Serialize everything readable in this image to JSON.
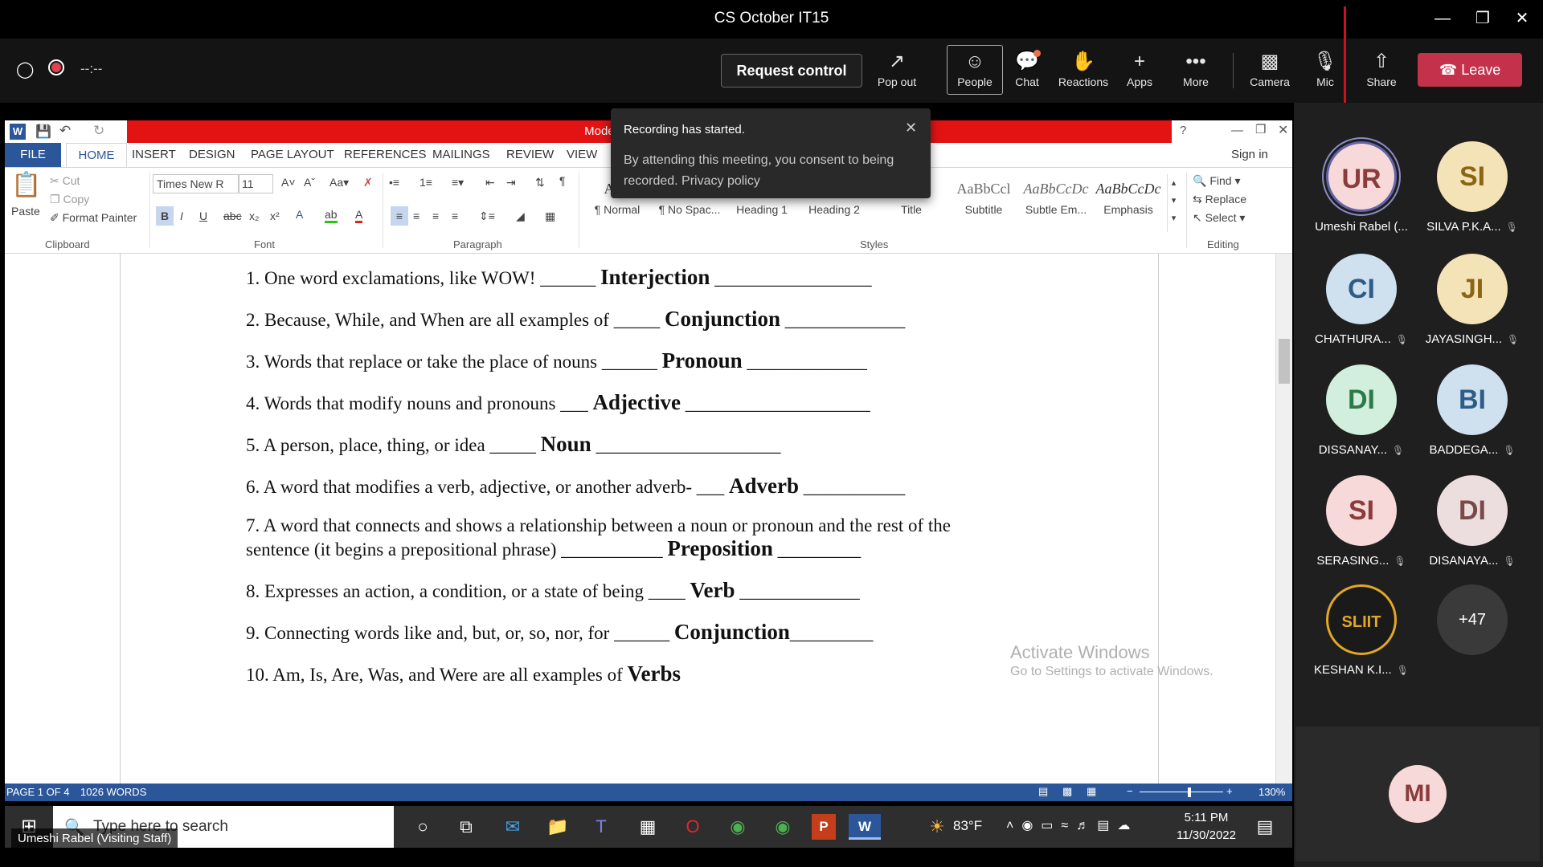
{
  "window": {
    "title": "CS October IT15"
  },
  "controls": {
    "timer": "--:--",
    "request_control": "Request control",
    "pop_out": "Pop out",
    "people": "People",
    "chat": "Chat",
    "reactions": "Reactions",
    "apps": "Apps",
    "more": "More",
    "camera": "Camera",
    "mic": "Mic",
    "share": "Share",
    "leave": "Leave"
  },
  "word": {
    "title": "Model Paper - Answer K",
    "tabs": [
      "FILE",
      "HOME",
      "INSERT",
      "DESIGN",
      "PAGE LAYOUT",
      "REFERENCES",
      "MAILINGS",
      "REVIEW",
      "VIEW"
    ],
    "sign_in": "Sign in",
    "clipboard": {
      "paste": "Paste",
      "cut": "Cut",
      "copy": "Copy",
      "format_painter": "Format Painter",
      "label": "Clipboard"
    },
    "font": {
      "name": "Times New R",
      "size": "11",
      "label": "Font"
    },
    "paragraph_label": "Paragraph",
    "styles": [
      {
        "preview": "AaB",
        "name": "¶ Normal"
      },
      {
        "preview": "",
        "name": "¶ No Spac..."
      },
      {
        "preview": "",
        "name": "Heading 1"
      },
      {
        "preview": "",
        "name": "Heading 2"
      },
      {
        "preview": "",
        "name": "Title"
      },
      {
        "preview": "AaBbCcl",
        "name": "Subtitle"
      },
      {
        "preview": "AaBbCcDc",
        "name": "Subtle Em..."
      },
      {
        "preview": "AaBbCcDc",
        "name": "Emphasis"
      }
    ],
    "styles_label": "Styles",
    "editing": {
      "find": "Find",
      "replace": "Replace",
      "select": "Select",
      "label": "Editing"
    },
    "questions": [
      {
        "prefix": "1. One word exclamations, like WOW! ______ ",
        "answer": "Interjection",
        "suffix": " _________________"
      },
      {
        "prefix": "2. Because, While, and When are all examples of _____ ",
        "answer": "Conjunction",
        "suffix": " _____________"
      },
      {
        "prefix": "3. Words that replace or take the place of nouns ______ ",
        "answer": "Pronoun",
        "suffix": " _____________"
      },
      {
        "prefix": "4. Words that modify nouns and pronouns ___ ",
        "answer": "Adjective",
        "suffix": " ____________________"
      },
      {
        "prefix": "5. A person, place, thing, or idea _____ ",
        "answer": "Noun",
        "suffix": " ____________________"
      },
      {
        "prefix": "6. A word that modifies a verb, adjective, or another adverb- ___ ",
        "answer": "Adverb",
        "suffix": " ___________"
      },
      {
        "prefix": "7. A word that connects and shows a relationship between a noun or pronoun and the rest of the",
        "answer": "",
        "suffix": ""
      },
      {
        "prefix": "sentence (it begins a prepositional phrase) ___________ ",
        "answer": "Preposition",
        "suffix": " _________"
      },
      {
        "prefix": "8. Expresses an action, a condition, or a state of being ____ ",
        "answer": "Verb",
        "suffix": " _____________"
      },
      {
        "prefix": "9. Connecting words like and, but, or, so, nor, for ______ ",
        "answer": "Conjunction",
        "suffix": "_________"
      },
      {
        "prefix": "10. Am, Is, Are, Was, and Were are all examples of      ",
        "answer": "Verbs",
        "suffix": ""
      }
    ],
    "status": {
      "page": "PAGE 1 OF 4",
      "words": "1026 WORDS",
      "zoom": "130%"
    },
    "activate_title": "Activate Windows",
    "activate_sub": "Go to Settings to activate Windows."
  },
  "toast": {
    "title": "Recording has started.",
    "body": "By attending this meeting, you consent to being recorded. Privacy policy"
  },
  "taskbar": {
    "search_placeholder": "Type here to search",
    "weather": "83°F",
    "time": "5:11 PM",
    "date": "11/30/2022",
    "presenter_tag": "Umeshi Rabel (Visiting Staff)"
  },
  "participants": [
    {
      "initials": "UR",
      "name": "Umeshi Rabel (...",
      "bg": "#f7d9d9",
      "fg": "#8a3b3b",
      "muted": false
    },
    {
      "initials": "SI",
      "name": "SILVA P.K.A...",
      "bg": "#f5e3b8",
      "fg": "#8a6515",
      "muted": true
    },
    {
      "initials": "CI",
      "name": "CHATHURA...",
      "bg": "#cfe0ee",
      "fg": "#2d5d86",
      "muted": true
    },
    {
      "initials": "JI",
      "name": "JAYASINGH...",
      "bg": "#f5e3b8",
      "fg": "#8a6515",
      "muted": true
    },
    {
      "initials": "DI",
      "name": "DISSANAY...",
      "bg": "#d2eedd",
      "fg": "#2c7a4a",
      "muted": true
    },
    {
      "initials": "BI",
      "name": "BADDEGA...",
      "bg": "#cfe0ee",
      "fg": "#2d5d86",
      "muted": true
    },
    {
      "initials": "SI",
      "name": "SERASING...",
      "bg": "#f7d9d9",
      "fg": "#8a3b3b",
      "muted": true
    },
    {
      "initials": "DI",
      "name": "DISANAYA...",
      "bg": "#ecdede",
      "fg": "#7a4a4a",
      "muted": true
    },
    {
      "initials": "SLIIT",
      "name": "KESHAN K.I...",
      "bg": "#1a1a1a",
      "fg": "#e2a724",
      "muted": true
    },
    {
      "initials": "+47",
      "name": "",
      "bg": "#3a3a3a",
      "fg": "#ffffff",
      "muted": false
    }
  ],
  "self": {
    "initials": "MI"
  },
  "colors": {
    "leave": "#c4314b",
    "word_blue": "#2b579a",
    "recording_red": "#e31313"
  }
}
